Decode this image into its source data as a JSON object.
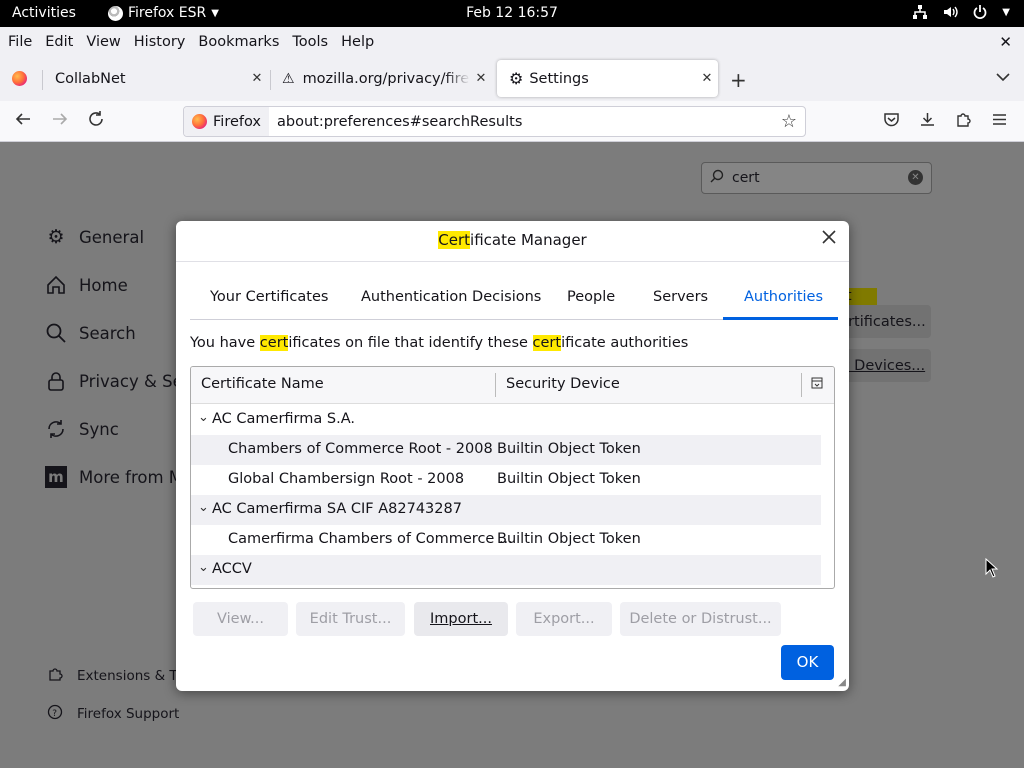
{
  "topbar": {
    "activities": "Activities",
    "app_name": "Firefox ESR",
    "clock": "Feb 12  16:57"
  },
  "menubar": {
    "file": "File",
    "edit": "Edit",
    "view": "View",
    "history": "History",
    "bookmarks": "Bookmarks",
    "tools": "Tools",
    "help": "Help"
  },
  "tabs": [
    {
      "title": "CollabNet"
    },
    {
      "title": "mozilla.org/privacy/firefox"
    },
    {
      "title": "Settings"
    }
  ],
  "navbar": {
    "identity_label": "Firefox",
    "url": "about:preferences#searchResults"
  },
  "settings": {
    "search_value": "cert",
    "categories": {
      "general": "General",
      "home": "Home",
      "search": "Search",
      "privacy": "Privacy & Security",
      "sync": "Sync",
      "more": "More from Mozilla"
    },
    "footer": {
      "extensions": "Extensions & Themes",
      "support": "Firefox Support"
    },
    "bg_tag": "cert",
    "bg_view_certificates": "View Certificates...",
    "bg_security_devices": "Security Devices..."
  },
  "dialog": {
    "title_highlight": "Cert",
    "title_rest": "ificate Manager",
    "tabs": {
      "your_certificates": "Your Certificates",
      "authentication_decisions": "Authentication Decisions",
      "people": "People",
      "servers": "Servers",
      "authorities": "Authorities"
    },
    "desc": {
      "p1": "You have ",
      "h1": "cert",
      "p2": "ificates on file that identify these ",
      "h2": "cert",
      "p3": "ificate authorities"
    },
    "columns": {
      "name": "Certificate Name",
      "device": "Security Device"
    },
    "rows": [
      {
        "name": "AC Camerfirma S.A.",
        "device": ""
      },
      {
        "name": "Chambers of Commerce Root - 2008",
        "device": "Builtin Object Token"
      },
      {
        "name": "Global Chambersign Root - 2008",
        "device": "Builtin Object Token"
      },
      {
        "name": "AC Camerfirma SA CIF A82743287",
        "device": ""
      },
      {
        "name": "Camerfirma Chambers of Commerce ...",
        "device": "Builtin Object Token"
      },
      {
        "name": "ACCV",
        "device": ""
      }
    ],
    "buttons": {
      "view": "View...",
      "edit_trust": "Edit Trust...",
      "import": "Import...",
      "export": "Export...",
      "delete": "Delete or Distrust..."
    },
    "ok": "OK"
  }
}
